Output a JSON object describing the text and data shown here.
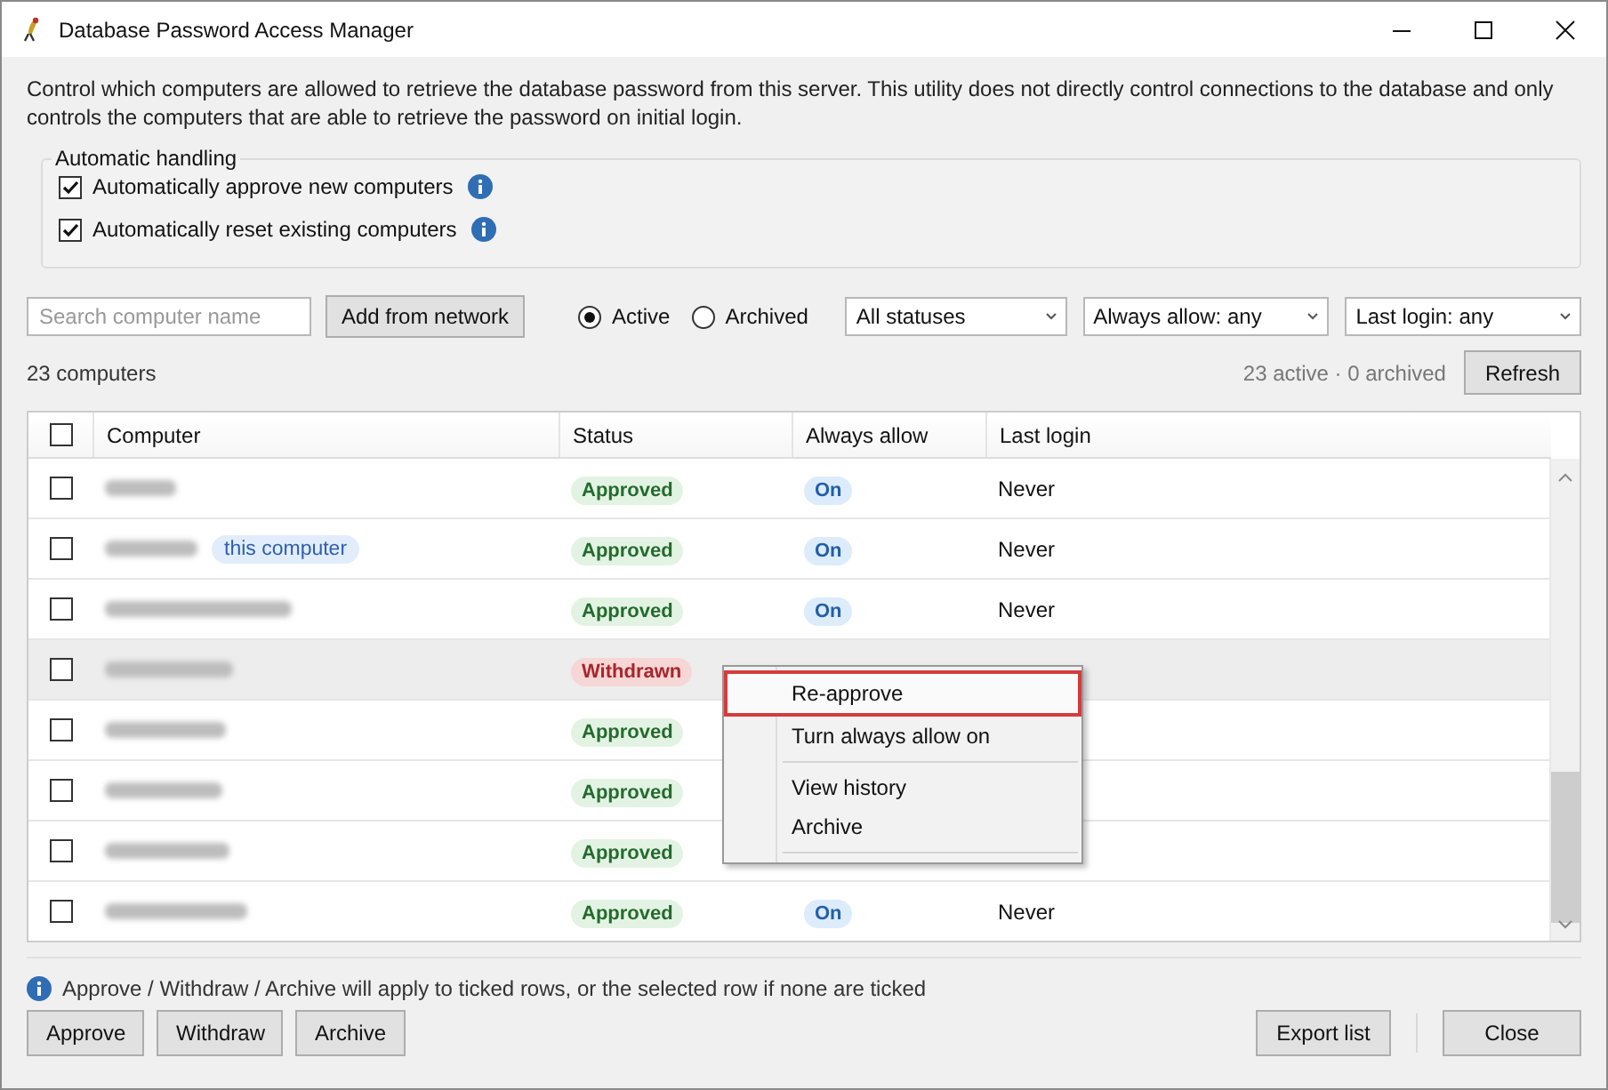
{
  "window": {
    "title": "Database Password Access Manager"
  },
  "description": "Control which computers are allowed to retrieve the database password from this server. This utility does not directly control connections to the database and only controls the computers that are able to retrieve the password on initial login.",
  "automatic_handling": {
    "title": "Automatic handling",
    "options": [
      {
        "label": "Automatically approve new computers",
        "checked": true
      },
      {
        "label": "Automatically reset existing computers",
        "checked": true
      }
    ]
  },
  "search": {
    "placeholder": "Search computer name"
  },
  "add_button": "Add from network",
  "view": [
    {
      "label": "Active",
      "selected": true
    },
    {
      "label": "Archived",
      "selected": false
    }
  ],
  "filters": [
    "All statuses",
    "Always allow: any",
    "Last login: any"
  ],
  "count": "23 computers",
  "summary": "23 active · 0 archived",
  "refresh_button": "Refresh",
  "table": {
    "all_checked": false,
    "columns": [
      "Computer",
      "Status",
      "Always allow",
      "Last login"
    ],
    "rows": [
      {
        "checked": false,
        "selected": false,
        "status": {
          "label": "Approved",
          "kind": "approved"
        },
        "always_allow": {
          "label": "On",
          "on": true
        },
        "last_login": "Never"
      },
      {
        "checked": false,
        "selected": false,
        "tag": "this computer",
        "status": {
          "label": "Approved",
          "kind": "approved"
        },
        "always_allow": {
          "label": "On",
          "on": true
        },
        "last_login": "Never"
      },
      {
        "checked": false,
        "selected": false,
        "status": {
          "label": "Approved",
          "kind": "approved"
        },
        "always_allow": {
          "label": "On",
          "on": true
        },
        "last_login": "Never"
      },
      {
        "checked": false,
        "selected": true,
        "status": {
          "label": "Withdrawn",
          "kind": "withdrawn"
        }
      },
      {
        "checked": false,
        "selected": false,
        "status": {
          "label": "Approved",
          "kind": "approved"
        }
      },
      {
        "checked": false,
        "selected": false,
        "status": {
          "label": "Approved",
          "kind": "approved"
        }
      },
      {
        "checked": false,
        "selected": false,
        "status": {
          "label": "Approved",
          "kind": "approved"
        }
      },
      {
        "checked": false,
        "selected": false,
        "status": {
          "label": "Approved",
          "kind": "approved"
        },
        "always_allow": {
          "label": "On",
          "on": true
        },
        "last_login": "Never"
      }
    ]
  },
  "context_menu": [
    {
      "kind": "item",
      "label": "Re-approve",
      "selected": true
    },
    {
      "kind": "item",
      "label": "Turn always allow on",
      "selected": false
    },
    {
      "kind": "separator"
    },
    {
      "kind": "item",
      "label": "View history",
      "selected": false
    },
    {
      "kind": "item",
      "label": "Archive",
      "selected": false
    },
    {
      "kind": "separator"
    }
  ],
  "hint": "Approve / Withdraw / Archive will apply to ticked rows, or the selected row if none are ticked",
  "footer": {
    "left_buttons": [
      "Approve",
      "Withdraw",
      "Archive"
    ],
    "right_buttons": [
      "Export list",
      "Close"
    ]
  }
}
